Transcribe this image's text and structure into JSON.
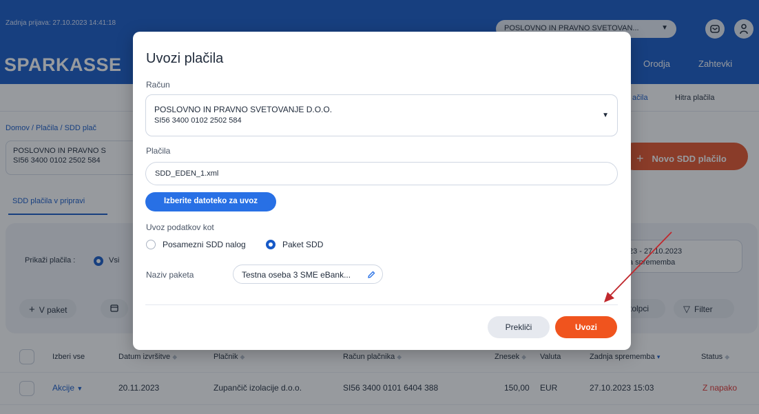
{
  "header": {
    "last_login": "Zadnja prijava: 27.10.2023 14:41:18",
    "company_select": "POSLOVNO IN PRAVNO SVETOVAN...",
    "brand": "SPARKASSE",
    "nav": {
      "tools": "Orodja",
      "requests": "Zahtevki"
    }
  },
  "subnav": {
    "payments": "ačila",
    "quick_payments": "Hitra plačila"
  },
  "breadcrumb": "Domov  /  Plačila  /  SDD plač",
  "account": {
    "name": "POSLOVNO IN PRAVNO S",
    "number": "SI56 3400 0102 2502 584"
  },
  "new_sdd_button": "Novo SDD plačilo",
  "tabs": {
    "draft": "SDD plačila v pripravi"
  },
  "filters": {
    "show_label": "Prikaži plačila :",
    "all_label": "Vsi",
    "date_range": "23 - 27.10.2023",
    "date_caption": "a sprememba",
    "add_to_package": "V paket",
    "columns": "tolpci",
    "filter": "Filter"
  },
  "table": {
    "select_all": "Izberi vse",
    "columns": [
      "Datum izvršitve",
      "Plačnik",
      "Račun plačnika",
      "Znesek",
      "Valuta",
      "Zadnja sprememba",
      "Status"
    ],
    "rows": [
      {
        "actions": "Akcije",
        "date": "20.11.2023",
        "payer": "Zupančič izolacije d.o.o.",
        "payer_account": "SI56 3400 0101 6404 388",
        "amount": "150,00",
        "currency": "EUR",
        "last_change": "27.10.2023 15:03",
        "status": "Z napako"
      }
    ]
  },
  "modal": {
    "title": "Uvozi plačila",
    "account_label": "Račun",
    "account_name": "POSLOVNO IN PRAVNO SVETOVANJE D.O.O.",
    "account_number": "SI56 3400 0102 2502 584",
    "payments_label": "Plačila",
    "file_value": "SDD_EDEN_1.xml",
    "choose_file_button": "Izberite datoteko za uvoz",
    "import_as_label": "Uvoz podatkov kot",
    "option_single": "Posamezni SDD nalog",
    "option_package": "Paket SDD",
    "option_selected": "Paket SDD",
    "package_name_label": "Naziv paketa",
    "package_name_value": "Testna oseba 3 SME eBank...",
    "cancel_button": "Prekliči",
    "import_button": "Uvozi"
  },
  "colors": {
    "brand_blue": "#1659c7",
    "accent_orange": "#f0541e",
    "status_error": "#e0312e",
    "annotation_arrow": "#c0282d"
  }
}
